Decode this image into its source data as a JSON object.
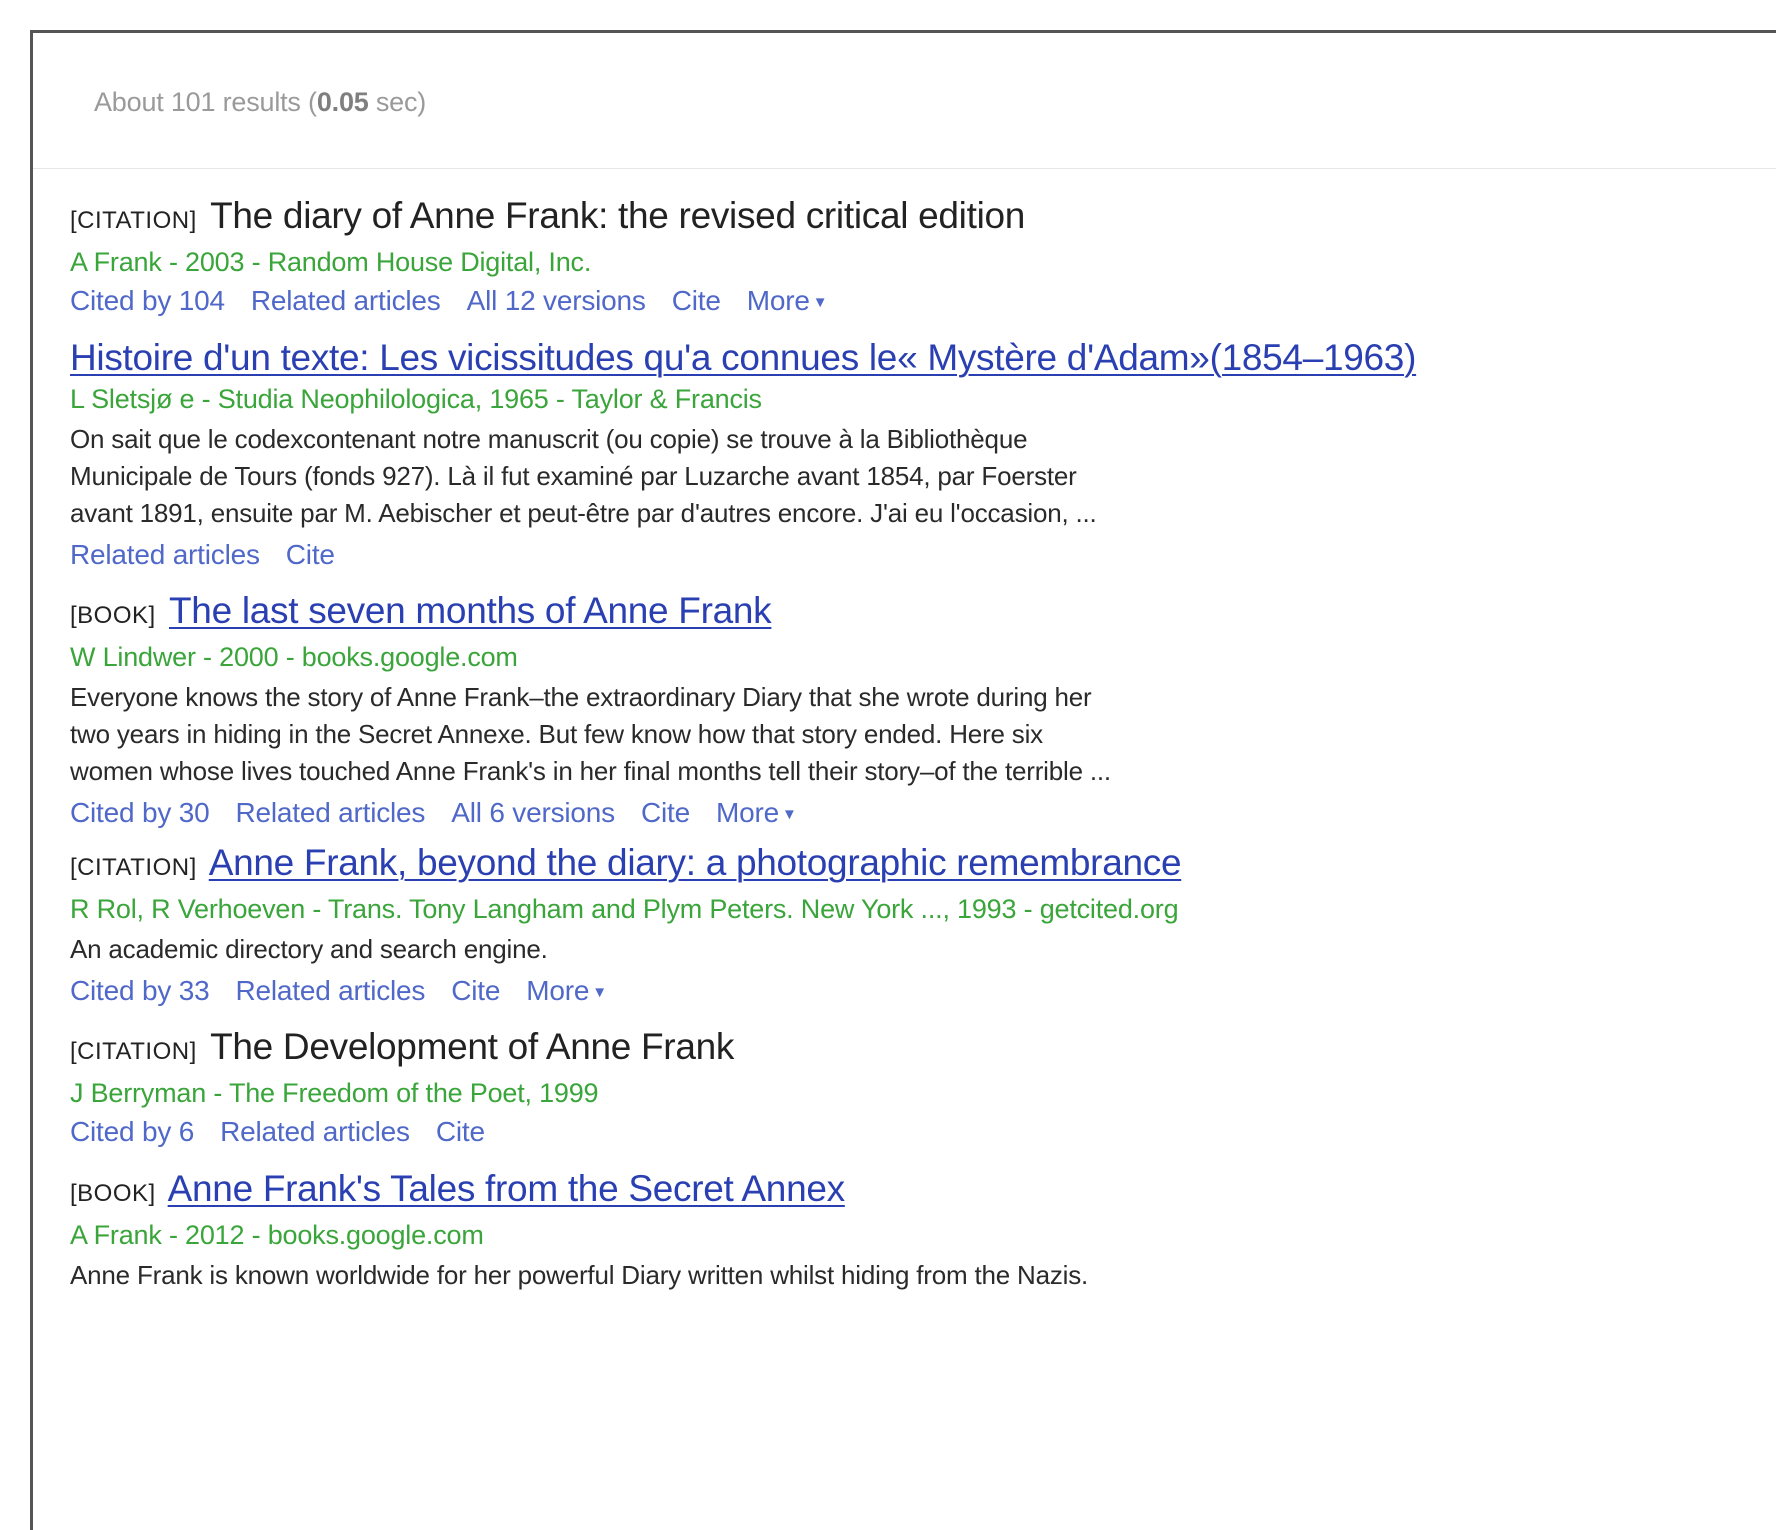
{
  "header": {
    "stats_prefix": "About 101 results (",
    "stats_time": "0.05",
    "stats_suffix": " sec)"
  },
  "results": [
    {
      "kind": "[CITATION]",
      "title": "The diary of Anne Frank: the revised critical edition",
      "meta": "A Frank - 2003 - Random House Digital, Inc.",
      "snippet": [],
      "links": [
        "Cited by 104",
        "Related articles",
        "All 12 versions",
        "Cite",
        "More"
      ]
    },
    {
      "kind": "",
      "title": "Histoire d'un texte: Les vicissitudes qu'a connues le« Mystère d'Adam»(1854–1963)",
      "meta": "L Sletsjø e - Studia Neophilologica, 1965 - Taylor & Francis",
      "snippet": [
        "On sait que le codexcontenant notre manuscrit (ou copie) se trouve à la Bibliothèque",
        "Municipale de Tours (fonds 927). Là il fut examiné par Luzarche avant 1854, par Foerster",
        "avant 1891, ensuite par M. Aebischer et peut-être par d'autres encore. J'ai eu l'occasion, ..."
      ],
      "links": [
        "Related articles",
        "Cite"
      ]
    },
    {
      "kind": "[BOOK]",
      "title": "The last seven months of Anne Frank",
      "meta": "W Lindwer - 2000 - books.google.com",
      "snippet": [
        "Everyone knows the story of Anne Frank–the extraordinary Diary that she wrote during her",
        "two years in hiding in the Secret Annexe. But few know how that story ended. Here six",
        "women whose lives touched Anne Frank's in her final months tell their story–of the terrible ..."
      ],
      "links": [
        "Cited by 30",
        "Related articles",
        "All 6 versions",
        "Cite",
        "More"
      ]
    },
    {
      "kind": "[CITATION]",
      "title": "Anne Frank, beyond the diary: a photographic remembrance",
      "meta": "R Rol, R Verhoeven - Trans. Tony Langham and Plym Peters. New York ..., 1993 - getcited.org",
      "snippet": [
        "An academic directory and search engine."
      ],
      "links": [
        "Cited by 33",
        "Related articles",
        "Cite",
        "More"
      ]
    },
    {
      "kind": "[CITATION]",
      "title": "The Development of Anne Frank",
      "meta": "J Berryman - The Freedom of the Poet, 1999",
      "snippet": [],
      "links": [
        "Cited by 6",
        "Related articles",
        "Cite"
      ]
    },
    {
      "kind": "[BOOK]",
      "title": "Anne Frank's Tales from the Secret Annex",
      "meta": "A Frank - 2012 - books.google.com",
      "snippet": [
        "Anne Frank is known worldwide for her powerful Diary written whilst hiding from the Nazis."
      ],
      "links": []
    }
  ]
}
